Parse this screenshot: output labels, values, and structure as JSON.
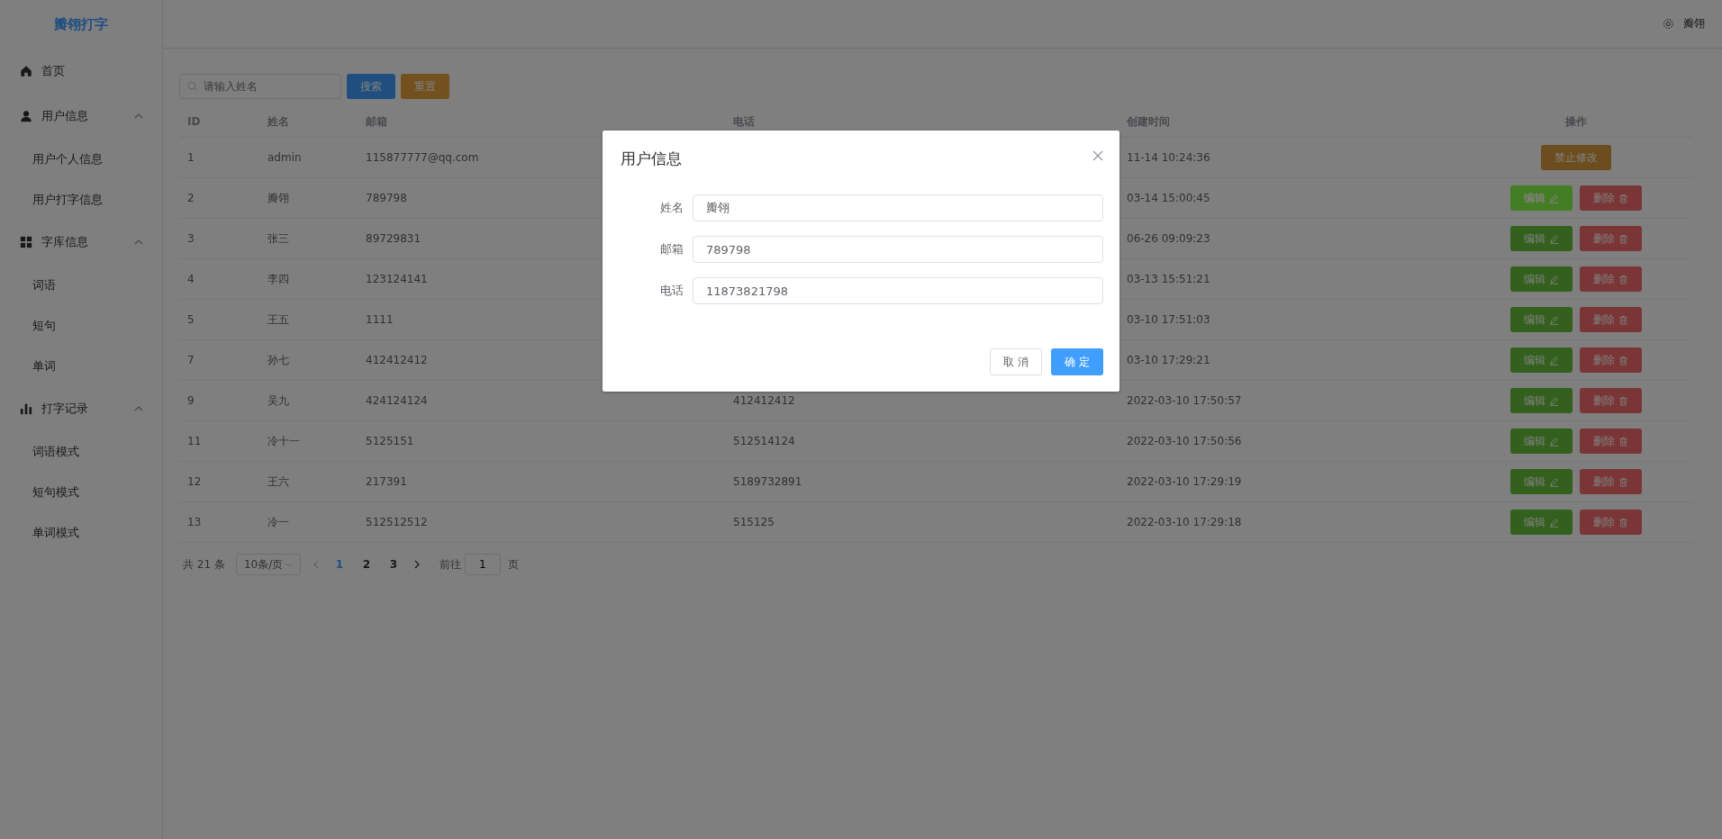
{
  "sidebar": {
    "logo": "瓣翎打字",
    "items": [
      {
        "label": "首页"
      },
      {
        "label": "用户信息",
        "expanded": true,
        "children": [
          {
            "label": "用户个人信息"
          },
          {
            "label": "用户打字信息"
          }
        ]
      },
      {
        "label": "字库信息",
        "expanded": true,
        "children": [
          {
            "label": "词语"
          },
          {
            "label": "短句"
          },
          {
            "label": "单词"
          }
        ]
      },
      {
        "label": "打字记录",
        "expanded": true,
        "children": [
          {
            "label": "词语模式"
          },
          {
            "label": "短句模式"
          },
          {
            "label": "单词模式"
          }
        ]
      }
    ]
  },
  "header": {
    "user": "瓣翎"
  },
  "search": {
    "placeholder": "请输入姓名",
    "buttons": [
      {
        "label": "搜索",
        "kind": "primary"
      },
      {
        "label": "重置",
        "kind": "warning"
      }
    ]
  },
  "table": {
    "columns": [
      "ID",
      "姓名",
      "邮箱",
      "电话",
      "创建时间",
      "操作"
    ],
    "rows": [
      {
        "id": "1",
        "name": "admin",
        "email": "115877777@qq.com",
        "created": "11-14 10:24:36",
        "actions": [
          {
            "label": "禁止修改",
            "kind": "locked",
            "highlighted": false
          }
        ]
      },
      {
        "id": "2",
        "name": "瓣翎",
        "email": "789798",
        "created": "03-14 15:00:45",
        "actions": [
          {
            "label": "编辑",
            "kind": "edit",
            "highlighted": true
          },
          {
            "label": "删除",
            "kind": "delete",
            "highlighted": false
          }
        ]
      },
      {
        "id": "3",
        "name": "张三",
        "email": "89729831",
        "created": "06-26 09:09:23",
        "actions": [
          {
            "label": "编辑",
            "kind": "edit",
            "highlighted": false
          },
          {
            "label": "删除",
            "kind": "delete",
            "highlighted": false
          }
        ]
      },
      {
        "id": "4",
        "name": "李四",
        "email": "123124141",
        "created": "03-13 15:51:21",
        "actions": [
          {
            "label": "编辑",
            "kind": "edit",
            "highlighted": false
          },
          {
            "label": "删除",
            "kind": "delete",
            "highlighted": false
          }
        ]
      },
      {
        "id": "5",
        "name": "王五",
        "email": "1111",
        "created": "03-10 17:51:03",
        "actions": [
          {
            "label": "编辑",
            "kind": "edit",
            "highlighted": false
          },
          {
            "label": "删除",
            "kind": "delete",
            "highlighted": false
          }
        ]
      },
      {
        "id": "7",
        "name": "孙七",
        "email": "412412412",
        "created": "03-10 17:29:21",
        "actions": [
          {
            "label": "编辑",
            "kind": "edit",
            "highlighted": false
          },
          {
            "label": "删除",
            "kind": "delete",
            "highlighted": false
          }
        ]
      },
      {
        "id": "9",
        "name": "吴九",
        "email": "424124124",
        "phone": "412412412",
        "created": "2022-03-10 17:50:57",
        "actions": [
          {
            "label": "编辑",
            "kind": "edit",
            "highlighted": false
          },
          {
            "label": "删除",
            "kind": "delete",
            "highlighted": false
          }
        ]
      },
      {
        "id": "11",
        "name": "冷十一",
        "email": "5125151",
        "phone": "512514124",
        "created": "2022-03-10 17:50:56",
        "actions": [
          {
            "label": "编辑",
            "kind": "edit",
            "highlighted": false
          },
          {
            "label": "删除",
            "kind": "delete",
            "highlighted": false
          }
        ]
      },
      {
        "id": "12",
        "name": "王六",
        "email": "217391",
        "phone": "5189732891",
        "created": "2022-03-10 17:29:19",
        "actions": [
          {
            "label": "编辑",
            "kind": "edit",
            "highlighted": false
          },
          {
            "label": "删除",
            "kind": "delete",
            "highlighted": false
          }
        ]
      },
      {
        "id": "13",
        "name": "冷一",
        "email": "512512512",
        "phone": "515125",
        "created": "2022-03-10 17:29:18",
        "actions": [
          {
            "label": "编辑",
            "kind": "edit",
            "highlighted": false
          },
          {
            "label": "删除",
            "kind": "delete",
            "highlighted": false
          }
        ]
      }
    ]
  },
  "pagination": {
    "total": "共 21 条",
    "page_size": "10条/页",
    "pages": [
      {
        "label": "1",
        "selected": true
      },
      {
        "label": "2",
        "selected": false
      },
      {
        "label": "3",
        "selected": false
      }
    ],
    "goto_label": "前往",
    "goto_value": "1",
    "goto_suffix": "页"
  },
  "dialog": {
    "title": "用户信息",
    "fields": [
      {
        "label": "姓名",
        "value": "瓣翎"
      },
      {
        "label": "邮箱",
        "value": "789798"
      },
      {
        "label": "电话",
        "value": "11873821798"
      }
    ],
    "buttons": [
      {
        "label": "取 消",
        "kind": "default"
      },
      {
        "label": "确 定",
        "kind": "primary"
      }
    ]
  }
}
